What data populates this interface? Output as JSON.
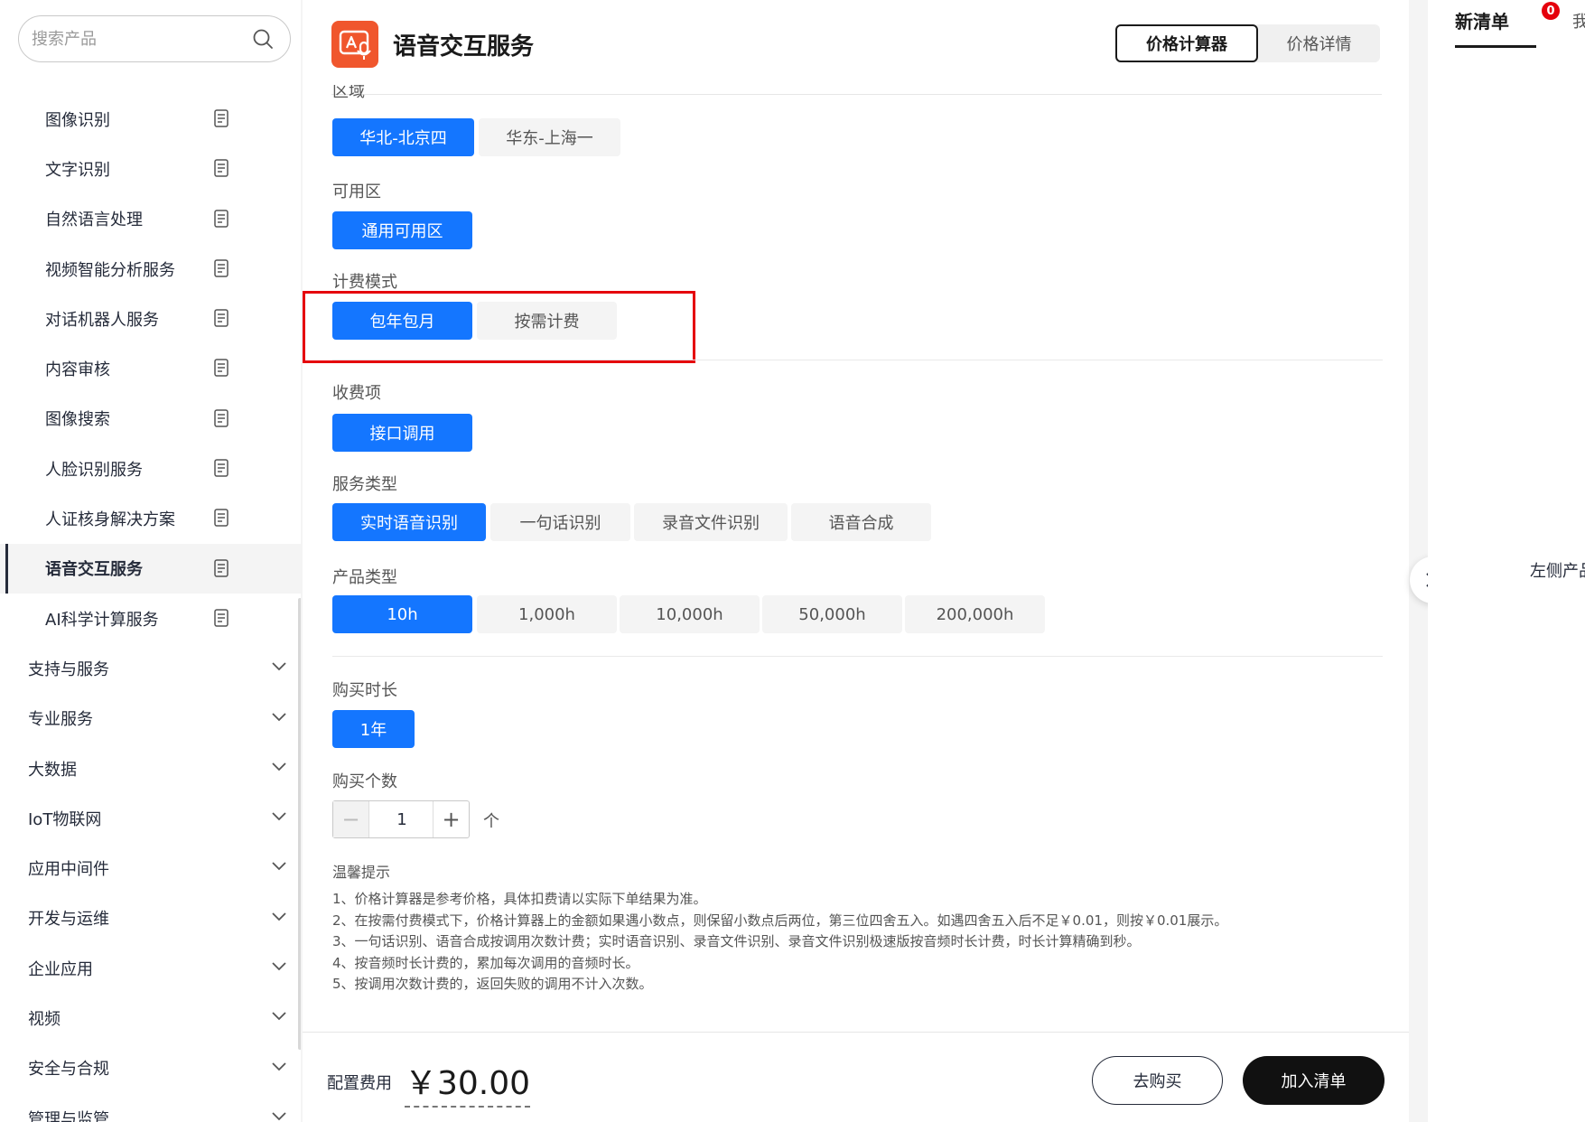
{
  "search": {
    "placeholder": "搜索产品"
  },
  "sidebar": {
    "sub_items": [
      {
        "label": "图像识别"
      },
      {
        "label": "文字识别"
      },
      {
        "label": "自然语言处理"
      },
      {
        "label": "视频智能分析服务"
      },
      {
        "label": "对话机器人服务"
      },
      {
        "label": "内容审核"
      },
      {
        "label": "图像搜索"
      },
      {
        "label": "人脸识别服务"
      },
      {
        "label": "人证核身解决方案"
      },
      {
        "label": "语音交互服务",
        "active": true
      },
      {
        "label": "AI科学计算服务"
      }
    ],
    "categories": [
      {
        "label": "支持与服务"
      },
      {
        "label": "专业服务"
      },
      {
        "label": "大数据"
      },
      {
        "label": "IoT物联网"
      },
      {
        "label": "应用中间件"
      },
      {
        "label": "开发与运维"
      },
      {
        "label": "企业应用"
      },
      {
        "label": "视频"
      },
      {
        "label": "安全与合规"
      },
      {
        "label": "管理与监管"
      }
    ]
  },
  "header": {
    "title": "语音交互服务",
    "tabs": [
      {
        "label": "价格计算器",
        "active": true
      },
      {
        "label": "价格详情"
      }
    ]
  },
  "config": {
    "region": {
      "label": "区域",
      "options": [
        "华北-北京四",
        "华东-上海一"
      ],
      "selected": "华北-北京四"
    },
    "zone": {
      "label": "可用区",
      "options": [
        "通用可用区"
      ],
      "selected": "通用可用区"
    },
    "billing": {
      "label": "计费模式",
      "options": [
        "包年包月",
        "按需计费"
      ],
      "selected": "包年包月"
    },
    "charge_item": {
      "label": "收费项",
      "options": [
        "接口调用"
      ],
      "selected": "接口调用"
    },
    "service_type": {
      "label": "服务类型",
      "options": [
        "实时语音识别",
        "一句话识别",
        "录音文件识别",
        "语音合成"
      ],
      "selected": "实时语音识别"
    },
    "product_type": {
      "label": "产品类型",
      "options": [
        "10h",
        "1,000h",
        "10,000h",
        "50,000h",
        "200,000h"
      ],
      "selected": "10h"
    },
    "duration": {
      "label": "购买时长",
      "options": [
        "1年"
      ],
      "selected": "1年"
    },
    "quantity": {
      "label": "购买个数",
      "value": "1",
      "unit": "个",
      "minus": "−",
      "plus": "+"
    }
  },
  "tips": {
    "title": "温馨提示",
    "items": [
      "1、价格计算器是参考价格，具体扣费请以实际下单结果为准。",
      "2、在按需付费模式下，价格计算器上的金额如果遇小数点，则保留小数点后两位，第三位四舍五入。如遇四舍五入后不足￥0.01，则按￥0.01展示。",
      "3、一句话识别、语音合成按调用次数计费；实时语音识别、录音文件识别、录音文件识别极速版按音频时长计费，时长计算精确到秒。",
      "4、按音频时长计费的，累加每次调用的音频时长。",
      "5、按调用次数计费的，返回失败的调用不计入次数。"
    ]
  },
  "footer": {
    "fee_label": "配置费用",
    "fee_value": "￥30.00",
    "buy_label": "去购买",
    "add_label": "加入清单"
  },
  "right_panel": {
    "tab_label": "新清单",
    "badge": "0",
    "tab2_label": "我",
    "hint": "左侧产品"
  },
  "colors": {
    "accent": "#1476ff",
    "highlight": "#e5000c",
    "logo": "#f0562d"
  }
}
